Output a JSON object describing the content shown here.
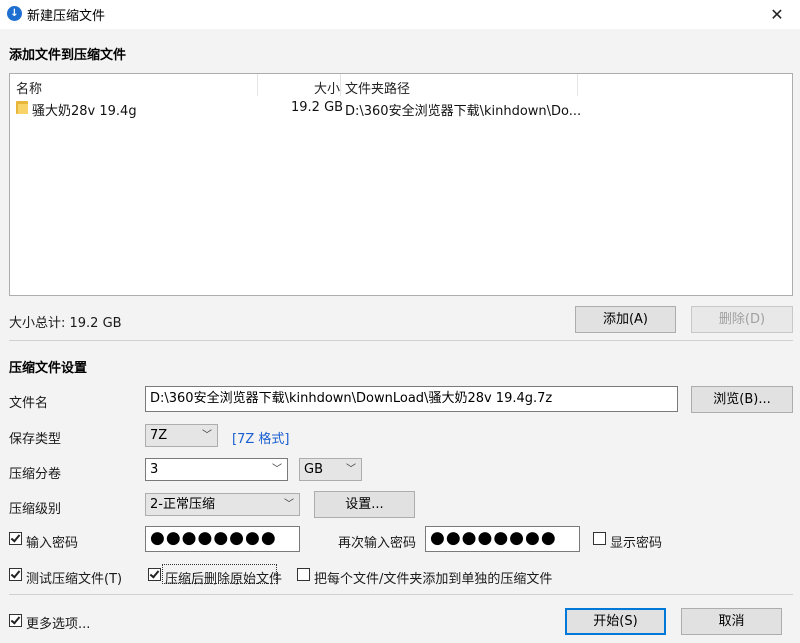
{
  "window": {
    "title": "新建压缩文件",
    "close_glyph": "✕"
  },
  "add_section": {
    "title": "添加文件到压缩文件",
    "columns": {
      "name": "名称",
      "size": "大小",
      "path": "文件夹路径"
    },
    "rows": [
      {
        "name": "骚大奶28v 19.4g",
        "size": "19.2 GB",
        "path": "D:\\360安全浏览器下载\\kinhdown\\Do..."
      }
    ],
    "total_label": "大小总计: 19.2 GB",
    "add_button": "添加(A)",
    "delete_button": "删除(D)"
  },
  "settings": {
    "title": "压缩文件设置",
    "filename_label": "文件名",
    "filename_value": "D:\\360安全浏览器下载\\kinhdown\\DownLoad\\骚大奶28v 19.4g.7z",
    "browse_button": "浏览(B)...",
    "save_type_label": "保存类型",
    "save_type_value": "7Z",
    "format_link": "[7Z 格式]",
    "split_label": "压缩分卷",
    "split_value": "3",
    "split_unit": "GB",
    "level_label": "压缩级别",
    "level_value": "2-正常压缩",
    "settings_button": "设置...",
    "password_checkbox": "输入密码",
    "password_checked": true,
    "password_value": "●●●●●●●●",
    "repeat_label": "再次输入密码",
    "repeat_value": "●●●●●●●●",
    "show_password": "显示密码",
    "show_password_checked": false,
    "test_archive": "测试压缩文件(T)",
    "test_archive_checked": true,
    "delete_after": "压缩后删除原始文件",
    "delete_after_checked": true,
    "separate_archives": "把每个文件/文件夹添加到单独的压缩文件",
    "separate_archives_checked": false
  },
  "footer": {
    "more_options": "更多选项...",
    "more_options_checked": true,
    "start_button": "开始(S)",
    "cancel_button": "取消"
  }
}
